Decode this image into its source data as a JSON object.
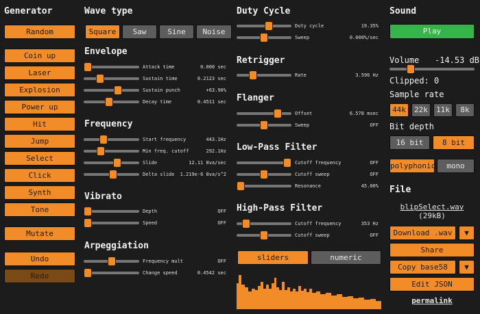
{
  "generator": {
    "title": "Generator",
    "buttons": [
      "Random",
      "Coin up",
      "Laser",
      "Explosion",
      "Power up",
      "Hit",
      "Jump",
      "Select",
      "Click",
      "Synth",
      "Tone",
      "Mutate",
      "Undo",
      "Redo"
    ]
  },
  "wave": {
    "title": "Wave type",
    "options": [
      "Square",
      "Saw",
      "Sine",
      "Noise"
    ],
    "selected": "Square"
  },
  "envelope": {
    "title": "Envelope",
    "params": [
      {
        "label": "Attack time",
        "value": "0.000 sec",
        "level": 0.0
      },
      {
        "label": "Sustain time",
        "value": "0.2123 sec",
        "level": 0.26
      },
      {
        "label": "Sustain punch",
        "value": "+63.90%",
        "level": 0.64
      },
      {
        "label": "Decay time",
        "value": "0.4511 sec",
        "level": 0.45
      }
    ]
  },
  "frequency": {
    "title": "Frequency",
    "params": [
      {
        "label": "Start frequency",
        "value": "443.1Hz",
        "level": 0.34
      },
      {
        "label": "Min freq. cutoff",
        "value": "292.1Hz",
        "level": 0.27
      },
      {
        "label": "Slide",
        "value": "12.11 8va/sec",
        "level": 0.62
      },
      {
        "label": "Delta slide",
        "value": "1.219e-6 8va/s^2",
        "level": 0.53
      }
    ]
  },
  "vibrato": {
    "title": "Vibrato",
    "params": [
      {
        "label": "Depth",
        "value": "OFF",
        "level": 0.0
      },
      {
        "label": "Speed",
        "value": "OFF",
        "level": 0.0
      }
    ]
  },
  "arpeggiation": {
    "title": "Arpeggiation",
    "params": [
      {
        "label": "Frequency mult",
        "value": "OFF",
        "level": 0.5
      },
      {
        "label": "Change speed",
        "value": "0.4542 sec",
        "level": 0.0
      }
    ]
  },
  "duty": {
    "title": "Duty Cycle",
    "params": [
      {
        "label": "Duty cycle",
        "value": "19.35%",
        "level": 0.6
      },
      {
        "label": "Sweep",
        "value": "0.000%/sec",
        "level": 0.5
      }
    ]
  },
  "retrigger": {
    "title": "Retrigger",
    "params": [
      {
        "label": "Rate",
        "value": "3.596 Hz",
        "level": 0.27
      }
    ]
  },
  "flanger": {
    "title": "Flanger",
    "params": [
      {
        "label": "Offset",
        "value": "6.578 msec",
        "level": 0.8
      },
      {
        "label": "Sweep",
        "value": "OFF",
        "level": 0.5
      }
    ]
  },
  "lowpass": {
    "title": "Low-Pass Filter",
    "params": [
      {
        "label": "Cutoff frequency",
        "value": "OFF",
        "level": 1.0
      },
      {
        "label": "Cutoff sweep",
        "value": "OFF",
        "level": 0.5
      },
      {
        "label": "Resonance",
        "value": "45.00%",
        "level": 0.0
      }
    ]
  },
  "highpass": {
    "title": "High-Pass Filter",
    "params": [
      {
        "label": "Cutoff frequency",
        "value": "353 Hz",
        "level": 0.12
      },
      {
        "label": "Cutoff sweep",
        "value": "OFF",
        "level": 0.5
      }
    ]
  },
  "view_toggle": {
    "options": [
      "sliders",
      "numeric"
    ],
    "selected": "sliders"
  },
  "sound": {
    "title": "Sound",
    "play": "Play",
    "volume_label": "Volume",
    "volume_value": "-14.53 dB",
    "volume_level": 0.22,
    "clipped": "Clipped: 0",
    "sample_rate_label": "Sample rate",
    "sample_rates": [
      "44k",
      "22k",
      "11k",
      "8k"
    ],
    "sample_rate_selected": "44k",
    "bit_depth_label": "Bit depth",
    "bit_depths": [
      "16 bit",
      "8 bit"
    ],
    "bit_depth_selected": "8 bit",
    "voice": [
      "polyphonic",
      "mono"
    ],
    "voice_selected": "polyphonic"
  },
  "file": {
    "title": "File",
    "filename": "blipSelect.wav",
    "size": "(29kB)",
    "download": "Download .wav",
    "share": "Share",
    "copy": "Copy base58",
    "edit": "Edit JSON",
    "permalink": "permalink"
  },
  "colors": {
    "accent": "#f28c28",
    "play": "#34b44a",
    "bg": "#1c1c1c",
    "button_off": "#5d5d5d"
  }
}
